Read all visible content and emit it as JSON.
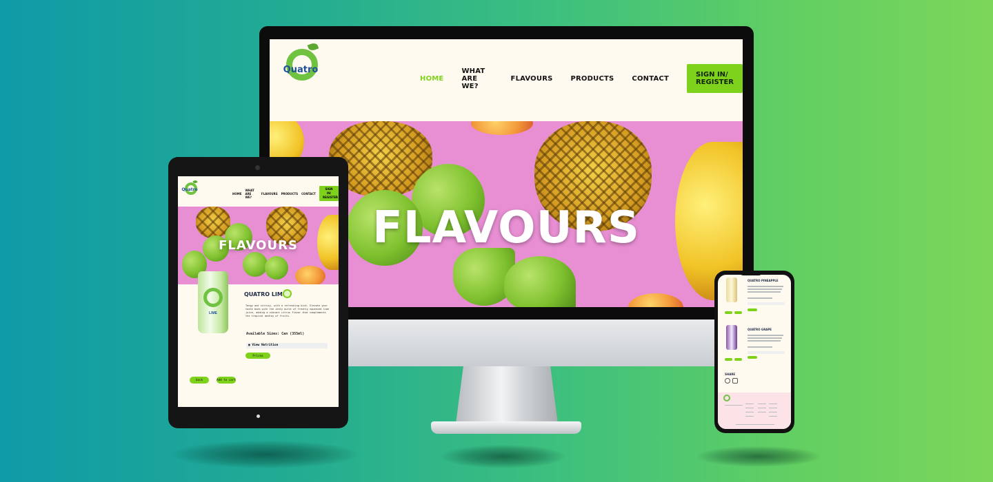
{
  "brand": {
    "name": "Quatro",
    "primary_color": "#7fd21c",
    "logo_ring_color": "#6fc341",
    "logo_text_color": "#1e4f9a"
  },
  "nav": {
    "items": [
      "HOME",
      "WHAT ARE WE?",
      "FLAVOURS",
      "PRODUCTS",
      "CONTACT"
    ],
    "active": "HOME",
    "signin_label": "SIGN IN/ REGISTER"
  },
  "hero": {
    "title": "FLAVOURS",
    "background_color": "#e88fd3"
  },
  "product": {
    "title": "QUATRO LIME",
    "can_label": "LIME",
    "description": "Tangy and citrusy, with a refreshing kick. Elevate your taste buds with the zesty burst of freshly squeezed lime juice, adding a vibrant citrus flavor that complements the tropical medley of fruits.",
    "sizes": "Available Sizes: Can (355ml)",
    "nutrition_label": "View Nutrition",
    "price_label": "Pricea",
    "back_label": "back",
    "cart_label": "Add to cart"
  },
  "phone": {
    "product_1_title": "QUATRO PINEAPPLE",
    "product_2_title": "QUATRO GRAPE",
    "shares_label": "SHARE"
  }
}
